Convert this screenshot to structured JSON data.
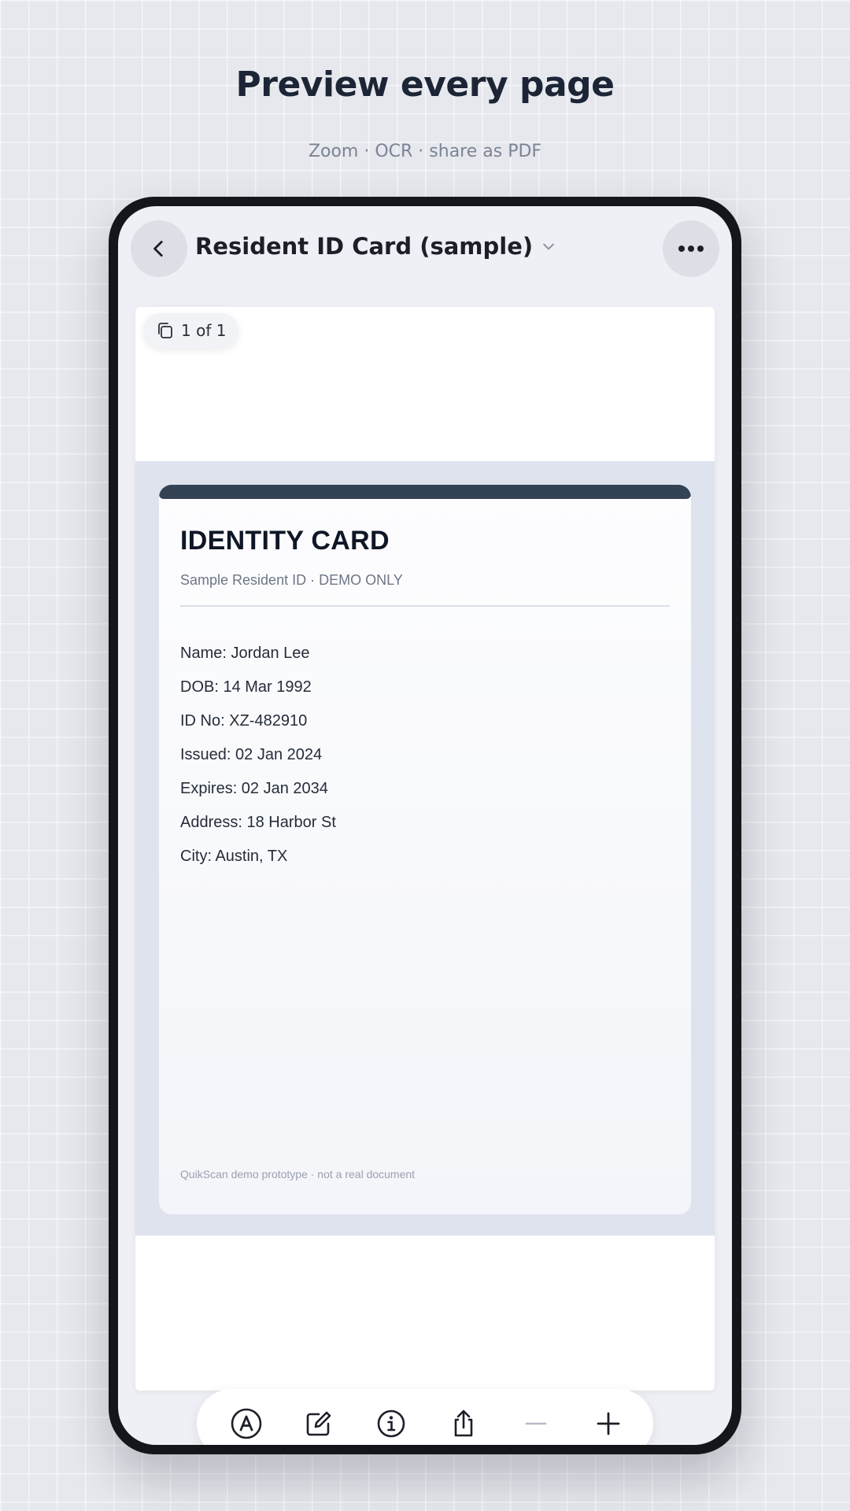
{
  "promo": {
    "headline": "Preview every page",
    "subline": "Zoom · OCR · share as PDF"
  },
  "header": {
    "title": "Resident ID Card (sample)",
    "back_icon": "chevron-left-icon",
    "dropdown_icon": "chevron-down-icon",
    "more_icon": "more-horizontal-icon"
  },
  "viewer": {
    "page_indicator": "1 of 1",
    "page_indicator_icon": "pages-icon"
  },
  "document": {
    "title": "IDENTITY CARD",
    "subtitle": "Sample Resident ID · DEMO ONLY",
    "fields": [
      "Name: Jordan Lee",
      "DOB: 14 Mar 1992",
      "ID No: XZ-482910",
      "Issued: 02 Jan 2024",
      "Expires: 02 Jan 2034",
      "Address: 18 Harbor St",
      "City: Austin, TX"
    ],
    "footer": "QuikScan demo prototype · not a real document"
  },
  "toolbar": {
    "tools": [
      "ocr-text-icon",
      "edit-icon",
      "info-icon",
      "share-icon",
      "zoom-out-icon",
      "zoom-in-icon"
    ]
  },
  "colors": {
    "background": "#e6e8ed",
    "accent_dark": "#344255",
    "device_frame": "#15161a"
  }
}
